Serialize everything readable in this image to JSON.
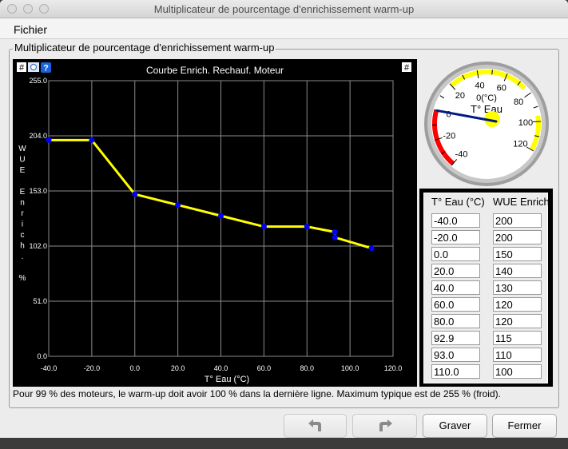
{
  "window": {
    "title": "Multiplicateur de pourcentage d'enrichissement warm-up"
  },
  "menu": {
    "items": [
      "Fichier"
    ]
  },
  "group": {
    "legend": "Multiplicateur de pourcentage d'enrichissement warm-up"
  },
  "chart_toolbar": {
    "left_hash": "#",
    "right_hash": "#",
    "help": "?"
  },
  "chart_data": {
    "type": "line",
    "title": "Courbe Enrich. Rechauf. Moteur",
    "xlabel": "T° Eau (°C)",
    "ylabel_chars": [
      "W",
      "U",
      "E",
      "",
      "E",
      "n",
      "r",
      "i",
      "c",
      "h",
      ".",
      "",
      "%"
    ],
    "x": [
      -40.0,
      -20.0,
      0.0,
      20.0,
      40.0,
      60.0,
      80.0,
      92.9,
      93.0,
      110.0
    ],
    "y": [
      200,
      200,
      150,
      140,
      130,
      120,
      120,
      115,
      110,
      100
    ],
    "xlim": [
      -40,
      120
    ],
    "ylim": [
      0,
      255
    ],
    "x_ticks": [
      "-40.0",
      "-20.0",
      "0.0",
      "20.0",
      "40.0",
      "60.0",
      "80.0",
      "100.0",
      "120.0"
    ],
    "y_ticks": [
      "0.0",
      "51.0",
      "102.0",
      "153.0",
      "204.0",
      "255.0"
    ],
    "line_color": "#ffff00",
    "point_color": "#0000ff",
    "grid": true
  },
  "gauge": {
    "label": "T° Eau",
    "unit": "0(°C)",
    "value": 0,
    "min": -40,
    "max": 120,
    "tick_labels": [
      "-40",
      "-20",
      "0",
      "20",
      "40",
      "60",
      "80",
      "100",
      "120"
    ],
    "colors": {
      "cold": "#ff0000",
      "hot": "#ffff00",
      "needle": "#001a80"
    }
  },
  "table": {
    "headers": [
      "T° Eau (°C)",
      "WUE Enrich"
    ],
    "rows": [
      [
        "-40.0",
        "200"
      ],
      [
        "-20.0",
        "200"
      ],
      [
        "0.0",
        "150"
      ],
      [
        "20.0",
        "140"
      ],
      [
        "40.0",
        "130"
      ],
      [
        "60.0",
        "120"
      ],
      [
        "80.0",
        "120"
      ],
      [
        "92.9",
        "115"
      ],
      [
        "93.0",
        "110"
      ],
      [
        "110.0",
        "100"
      ]
    ]
  },
  "status": "Pour 99 % des moteurs, le warm-up doit avoir 100 % dans la dernière ligne. Maximum typique est de 255 % (froid).",
  "buttons": {
    "undo_icon": "undo-arrow-icon",
    "redo_icon": "redo-arrow-icon",
    "burn": "Graver",
    "close": "Fermer"
  }
}
